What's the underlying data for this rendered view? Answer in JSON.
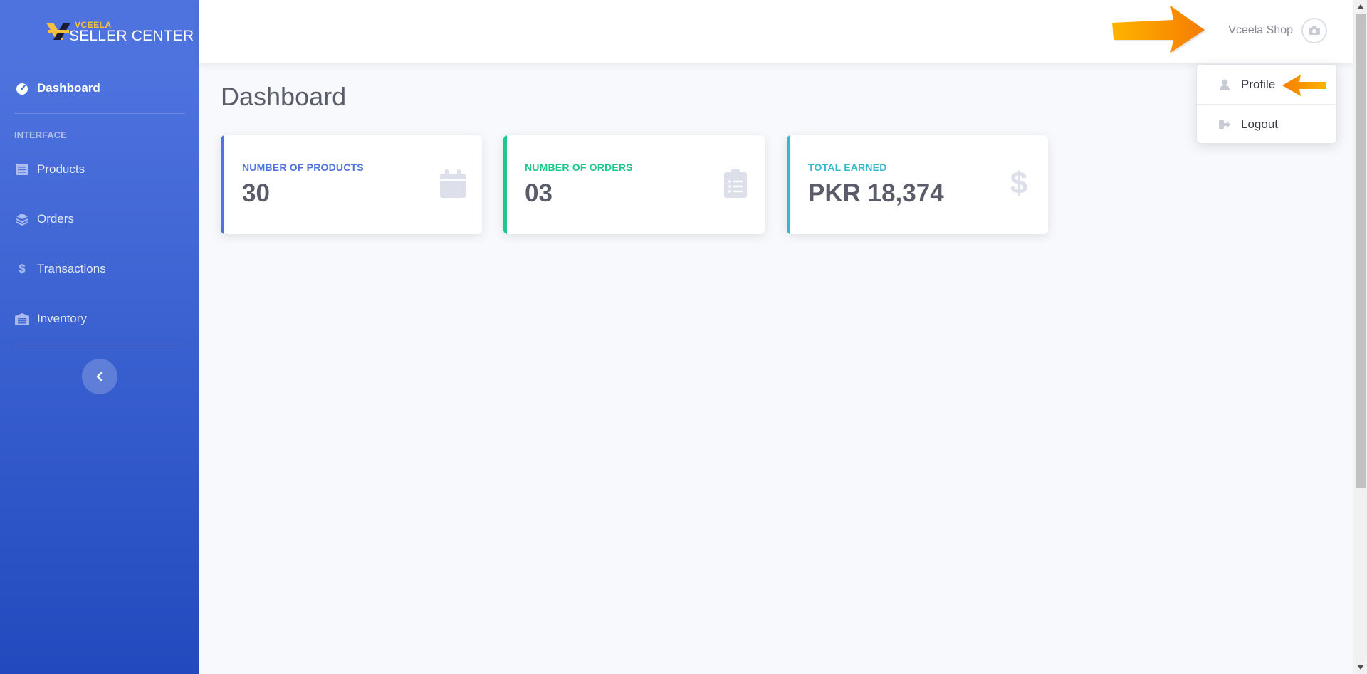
{
  "brand": {
    "top": "VCEELA",
    "bottom": "SELLER CENTER"
  },
  "sidebar": {
    "active": {
      "label": "Dashboard",
      "icon": "tachometer-icon"
    },
    "section_heading": "INTERFACE",
    "items": [
      {
        "label": "Products",
        "icon": "list-icon"
      },
      {
        "label": "Orders",
        "icon": "layers-icon"
      },
      {
        "label": "Transactions",
        "icon": "dollar-icon"
      },
      {
        "label": "Inventory",
        "icon": "warehouse-icon"
      }
    ],
    "toggle_icon": "chevron-left-icon"
  },
  "topbar": {
    "user_name": "Vceela Shop",
    "avatar_icon": "camera-icon"
  },
  "dropdown": {
    "items": [
      {
        "label": "Profile",
        "icon": "user-icon"
      },
      {
        "label": "Logout",
        "icon": "sign-out-icon"
      }
    ]
  },
  "main": {
    "title": "Dashboard",
    "cards": [
      {
        "label": "NUMBER OF PRODUCTS",
        "value": "30",
        "color": "#4e73df",
        "icon": "calendar-icon"
      },
      {
        "label": "NUMBER OF ORDERS",
        "value": "03",
        "color": "#1cc88a",
        "icon": "clipboard-list-icon"
      },
      {
        "label": "TOTAL EARNED",
        "value": "PKR 18,374",
        "color": "#36b9cc",
        "icon": "dollar-sign-icon"
      }
    ]
  },
  "colors": {
    "sidebar_start": "#4e73df",
    "sidebar_end": "#224abe",
    "annotation_arrow": "#f57c00"
  }
}
